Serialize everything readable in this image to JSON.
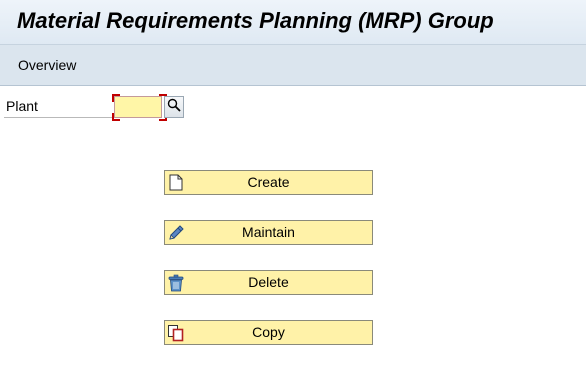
{
  "header": {
    "title": "Material Requirements Planning (MRP) Group"
  },
  "toolbar": {
    "overview_label": "Overview"
  },
  "form": {
    "plant_label": "Plant",
    "plant_value": "",
    "plant_placeholder": ""
  },
  "actions": {
    "create_label": "Create",
    "maintain_label": "Maintain",
    "delete_label": "Delete",
    "copy_label": "Copy"
  },
  "colors": {
    "button_background": "#fff2a8",
    "required_marker": "#c00000",
    "input_background": "#fff6a7"
  }
}
